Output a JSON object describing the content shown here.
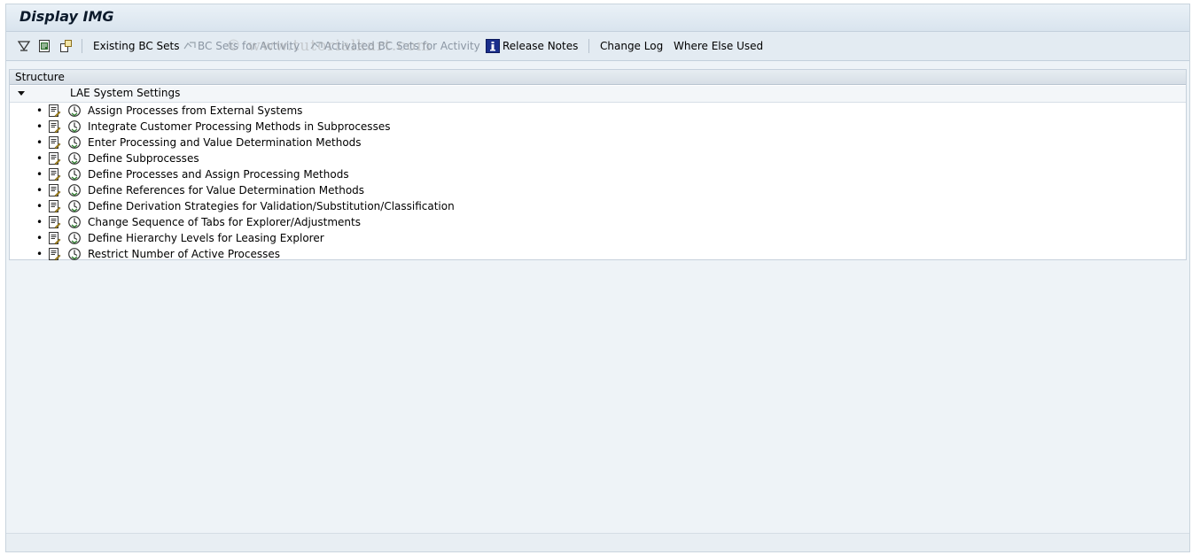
{
  "window": {
    "title": "Display IMG"
  },
  "toolbar": {
    "existing_bc_sets": "Existing BC Sets",
    "bc_sets_for_activity": "BC Sets for Activity",
    "activated_bc_sets": "Activated BC Sets for Activity",
    "release_notes": "Release Notes",
    "change_log": "Change Log",
    "where_else_used": "Where Else Used",
    "watermark": "© www.tutorialkart.com"
  },
  "tree": {
    "header": "Structure",
    "root": "LAE System Settings",
    "items": [
      {
        "label": "Assign Processes from External Systems"
      },
      {
        "label": "Integrate Customer Processing Methods in Subprocesses"
      },
      {
        "label": "Enter Processing and Value Determination Methods"
      },
      {
        "label": "Define Subprocesses"
      },
      {
        "label": "Define Processes and Assign Processing Methods"
      },
      {
        "label": "Define References for Value Determination Methods"
      },
      {
        "label": "Define Derivation Strategies for Validation/Substitution/Classification"
      },
      {
        "label": "Change Sequence of Tabs for Explorer/Adjustments"
      },
      {
        "label": "Define Hierarchy Levels for Leasing Explorer"
      },
      {
        "label": "Restrict Number of Active Processes"
      }
    ]
  }
}
